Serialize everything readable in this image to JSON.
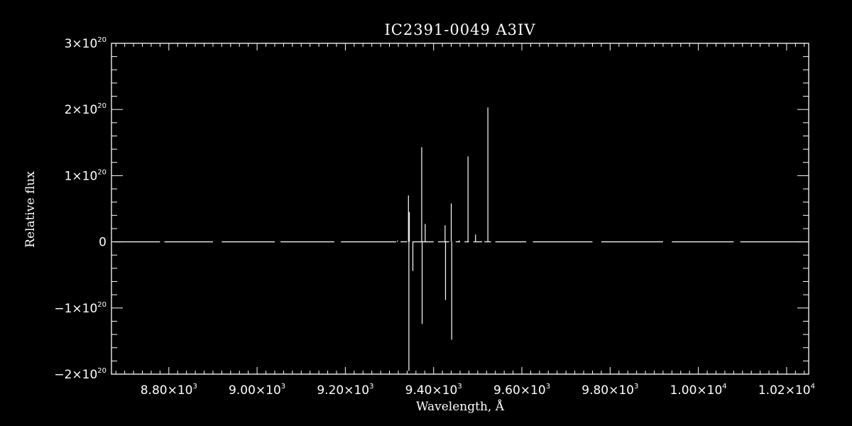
{
  "chart_data": {
    "type": "line",
    "title": "IC2391-0049   A3IV",
    "xlabel": "Wavelength, Å",
    "ylabel": "Relative flux",
    "xlim": [
      8670,
      10250
    ],
    "ylim": [
      -2e+20,
      3e+20
    ],
    "x_ticks": [
      {
        "value": 8800,
        "mantissa": "8.80",
        "exp": "3"
      },
      {
        "value": 9000,
        "mantissa": "9.00",
        "exp": "3"
      },
      {
        "value": 9200,
        "mantissa": "9.20",
        "exp": "3"
      },
      {
        "value": 9400,
        "mantissa": "9.40",
        "exp": "3"
      },
      {
        "value": 9600,
        "mantissa": "9.60",
        "exp": "3"
      },
      {
        "value": 9800,
        "mantissa": "9.80",
        "exp": "3"
      },
      {
        "value": 10000,
        "mantissa": "1.00",
        "exp": "4"
      },
      {
        "value": 10200,
        "mantissa": "1.02",
        "exp": "4"
      }
    ],
    "y_ticks": [
      {
        "value": 3e+20,
        "mantissa": "3",
        "exp": "20",
        "sign": ""
      },
      {
        "value": 2e+20,
        "mantissa": "2",
        "exp": "20",
        "sign": ""
      },
      {
        "value": 1e+20,
        "mantissa": "1",
        "exp": "20",
        "sign": ""
      },
      {
        "value": 0,
        "mantissa": "0",
        "exp": "",
        "sign": ""
      },
      {
        "value": -1e+20,
        "mantissa": "1",
        "exp": "20",
        "sign": "−"
      },
      {
        "value": -2e+20,
        "mantissa": "2",
        "exp": "20",
        "sign": "−"
      }
    ],
    "x_minor_step": 20,
    "y_minor_step": 2e+19,
    "baseline_segments": [
      [
        8675,
        8780
      ],
      [
        8790,
        8900
      ],
      [
        8920,
        9040
      ],
      [
        9053,
        9175
      ],
      [
        9190,
        9315
      ],
      [
        9325,
        9340
      ],
      [
        9352,
        9400
      ],
      [
        9410,
        9435
      ],
      [
        9450,
        9460
      ],
      [
        9470,
        9480
      ],
      [
        9490,
        9510
      ],
      [
        9515,
        9530
      ],
      [
        9540,
        9610
      ],
      [
        9625,
        9760
      ],
      [
        9780,
        9920
      ],
      [
        9940,
        10080
      ],
      [
        10095,
        10248
      ]
    ],
    "spikes": [
      {
        "x": 9318,
        "y": 2e+18
      },
      {
        "x": 9343,
        "y": 7e+19
      },
      {
        "x": 9344,
        "y": -1.95e+20
      },
      {
        "x": 9345,
        "y": 4.5e+19
      },
      {
        "x": 9353,
        "y": -4.4e+19
      },
      {
        "x": 9373,
        "y": 1.43e+20
      },
      {
        "x": 9374,
        "y": -1.24e+20
      },
      {
        "x": 9381,
        "y": 2.7e+19
      },
      {
        "x": 9426,
        "y": 2.5e+19
      },
      {
        "x": 9427,
        "y": -8.8e+19
      },
      {
        "x": 9440,
        "y": 5.8e+19
      },
      {
        "x": 9441,
        "y": -1.48e+20
      },
      {
        "x": 9458,
        "y": 2e+18
      },
      {
        "x": 9478,
        "y": 1.29e+20
      },
      {
        "x": 9495,
        "y": 1.1e+19
      },
      {
        "x": 9523,
        "y": 2.03e+20
      }
    ],
    "grid": false,
    "colors": {
      "background": "#000000",
      "foreground": "#ffffff"
    }
  }
}
